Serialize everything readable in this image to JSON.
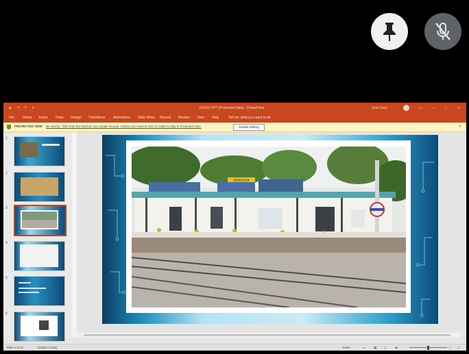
{
  "meeting": {
    "pin_icon": "pin-icon",
    "mic_off_icon": "mic-off-icon"
  },
  "ppt": {
    "title": "XXXXX PPT [Protected View] - PowerPoint",
    "user": "Xxxx Xxxx",
    "ribbon_tabs": [
      "File",
      "Home",
      "Insert",
      "Draw",
      "Design",
      "Transitions",
      "Animations",
      "Slide Show",
      "Record",
      "Review",
      "View",
      "Help",
      "Tell me what you want to do"
    ],
    "protected_label": "PROTECTED VIEW",
    "protected_msg": "Be careful - files from the Internet can contain viruses. Unless you need to edit, it's safer to stay in Protected View.",
    "enable_editing": "Enable Editing",
    "slide_numbers": [
      "1",
      "2",
      "3",
      "4",
      "5",
      "6"
    ],
    "selected_slide": 3,
    "station_sign": "XXXXXXX",
    "status_slide": "Slide 3 of 21",
    "status_lang": "English (India)",
    "status_notes": "Notes",
    "zoom_level": 0.5
  },
  "colors": {
    "accent": "#c8471f",
    "slide_blue": "#1f8fc0"
  }
}
